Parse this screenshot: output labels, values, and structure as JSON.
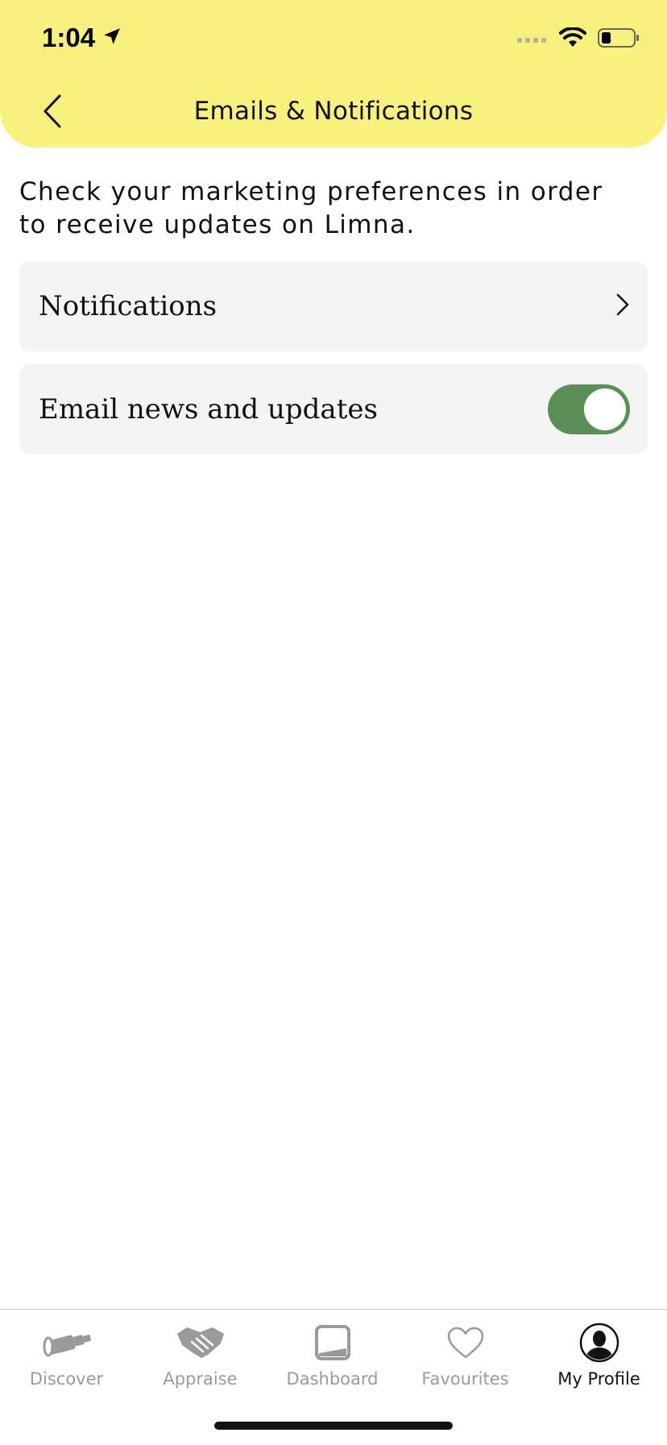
{
  "status_bar": {
    "time": "1:04"
  },
  "header": {
    "title": "Emails & Notifications"
  },
  "intro_text": "Check your marketing preferences in order to receive updates on Limna.",
  "rows": {
    "notifications": {
      "label": "Notifications"
    },
    "email_updates": {
      "label": "Email news and updates",
      "enabled": true
    }
  },
  "colors": {
    "header_bg": "#f9f17d",
    "toggle_on": "#5a8f55",
    "row_bg": "#f4f4f4",
    "tab_inactive": "#9a9a9a",
    "tab_active": "#111111"
  },
  "tabs": [
    {
      "label": "Discover",
      "icon": "telescope-icon",
      "active": false
    },
    {
      "label": "Appraise",
      "icon": "handshake-icon",
      "active": false
    },
    {
      "label": "Dashboard",
      "icon": "laptop-icon",
      "active": false
    },
    {
      "label": "Favourites",
      "icon": "heart-icon",
      "active": false
    },
    {
      "label": "My Profile",
      "icon": "profile-icon",
      "active": true
    }
  ]
}
